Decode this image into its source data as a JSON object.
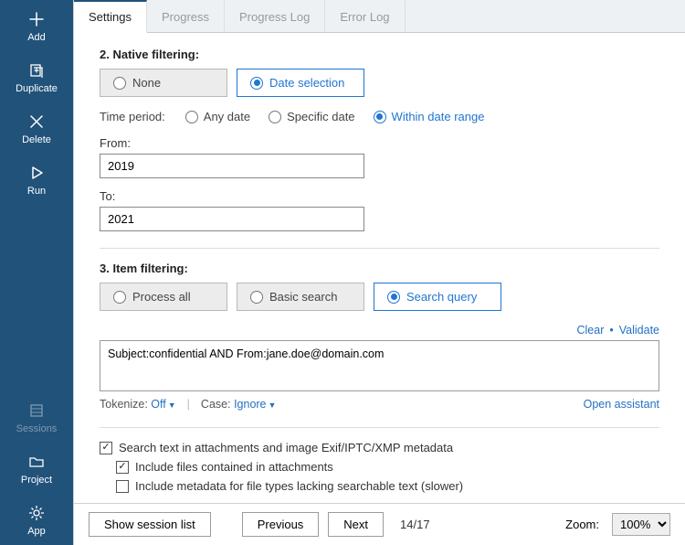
{
  "colors": {
    "sidebar_bg": "#21527a",
    "accent": "#1f76d1"
  },
  "sidebar": {
    "top": [
      {
        "label": "Add",
        "icon": "plus"
      },
      {
        "label": "Duplicate",
        "icon": "duplicate"
      },
      {
        "label": "Delete",
        "icon": "x"
      },
      {
        "label": "Run",
        "icon": "play"
      }
    ],
    "bottom": [
      {
        "label": "Sessions",
        "icon": "sessions",
        "dim": true
      },
      {
        "label": "Project",
        "icon": "folder"
      },
      {
        "label": "App",
        "icon": "gear"
      }
    ]
  },
  "tabs": [
    "Settings",
    "Progress",
    "Progress Log",
    "Error Log"
  ],
  "section_native": {
    "title": "2. Native filtering:",
    "options": [
      "None",
      "Date selection"
    ],
    "time_label": "Time period:",
    "time_options": [
      "Any date",
      "Specific date",
      "Within date range"
    ],
    "from_label": "From:",
    "from_value": "2019",
    "to_label": "To:",
    "to_value": "2021"
  },
  "section_item": {
    "title": "3. Item filtering:",
    "options": [
      "Process all",
      "Basic search",
      "Search query"
    ],
    "actions": {
      "clear": "Clear",
      "validate": "Validate"
    },
    "query": "Subject:confidential AND From:jane.doe@domain.com",
    "tokenize_label": "Tokenize:",
    "tokenize_value": "Off",
    "case_label": "Case:",
    "case_value": "Ignore",
    "open_assistant": "Open assistant",
    "checks": {
      "c1": "Search text in attachments and image Exif/IPTC/XMP metadata",
      "c2": "Include files contained in attachments",
      "c3": "Include metadata for file types lacking searchable text (slower)"
    }
  },
  "footer": {
    "show_sessions": "Show session list",
    "prev": "Previous",
    "next": "Next",
    "page": "14/17",
    "zoom_label": "Zoom:",
    "zoom_value": "100%"
  }
}
